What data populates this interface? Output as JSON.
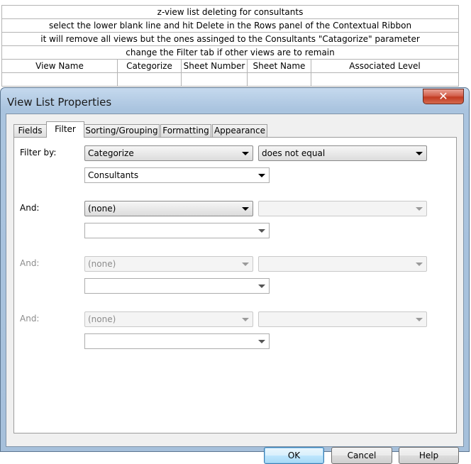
{
  "schedule": {
    "title": "z-view list deleting for consultants",
    "notes": [
      "select the lower blank line and hit Delete in the Rows panel of the Contextual Ribbon",
      "it will remove all views but the ones assinged to the Consultants \"Catagorize\" parameter",
      "change the Filter tab if other views are to remain"
    ],
    "columns": [
      "View Name",
      "Categorize",
      "Sheet Number",
      "Sheet Name",
      "Associated Level"
    ]
  },
  "dialog": {
    "title": "View List Properties",
    "close_glyph": "✕",
    "tabs": [
      {
        "label": "Fields",
        "active": false
      },
      {
        "label": "Filter",
        "active": true
      },
      {
        "label": "Sorting/Grouping",
        "active": false
      },
      {
        "label": "Formatting",
        "active": false
      },
      {
        "label": "Appearance",
        "active": false
      }
    ],
    "filters": [
      {
        "label": "Filter by:",
        "field": "Categorize",
        "condition": "does not equal",
        "value": "Consultants",
        "enabled": true
      },
      {
        "label": "And:",
        "field": "(none)",
        "condition": "",
        "value": "",
        "enabled": true
      },
      {
        "label": "And:",
        "field": "(none)",
        "condition": "",
        "value": "",
        "enabled": false
      },
      {
        "label": "And:",
        "field": "(none)",
        "condition": "",
        "value": "",
        "enabled": false
      }
    ],
    "buttons": {
      "ok": "OK",
      "cancel": "Cancel",
      "help": "Help"
    }
  },
  "colors": {
    "frame": "#a6c0db",
    "close": "#c23a22",
    "default_button": "#bee6fd",
    "disabled_text": "#8c8c8c"
  }
}
